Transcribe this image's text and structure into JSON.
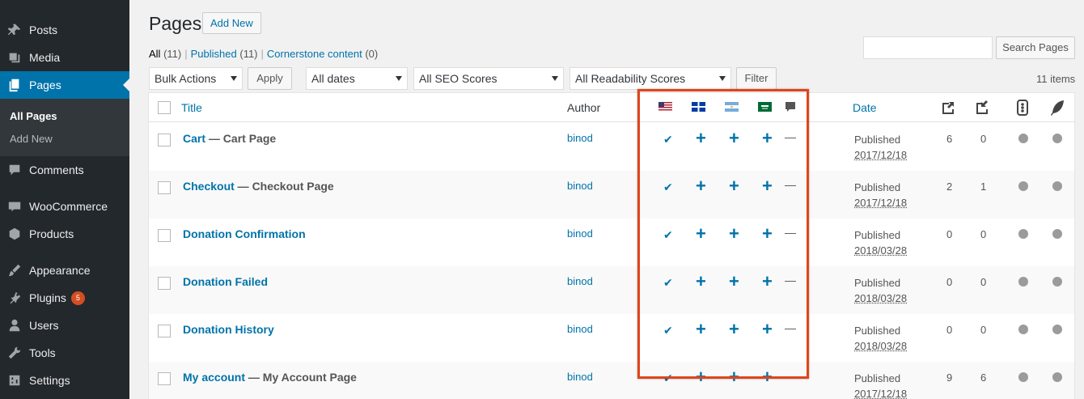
{
  "sidebar": {
    "items": [
      {
        "label": "Posts",
        "icon": "pin-icon"
      },
      {
        "label": "Media",
        "icon": "media-icon"
      },
      {
        "label": "Pages",
        "icon": "pages-icon"
      },
      {
        "label": "Comments",
        "icon": "comment-icon"
      },
      {
        "label": "WooCommerce",
        "icon": "woocommerce-icon"
      },
      {
        "label": "Products",
        "icon": "box-icon"
      },
      {
        "label": "Appearance",
        "icon": "brush-icon"
      },
      {
        "label": "Plugins",
        "icon": "plugin-icon"
      },
      {
        "label": "Users",
        "icon": "user-icon"
      },
      {
        "label": "Tools",
        "icon": "wrench-icon"
      },
      {
        "label": "Settings",
        "icon": "settings-icon"
      }
    ],
    "plugins_badge": "5",
    "submenu": {
      "all_pages": "All Pages",
      "add_new": "Add New"
    }
  },
  "header": {
    "title": "Pages",
    "add_new": "Add New"
  },
  "filters": {
    "all": "All",
    "all_count": "(11)",
    "published": "Published",
    "published_count": "(11)",
    "cornerstone": "Cornerstone content",
    "cornerstone_count": "(0)"
  },
  "search": {
    "button": "Search Pages"
  },
  "toolbar": {
    "bulk_actions": "Bulk Actions",
    "apply": "Apply",
    "dates": "All dates",
    "seo": "All SEO Scores",
    "readability": "All Readability Scores",
    "filter": "Filter",
    "items_count": "11 items"
  },
  "table": {
    "headers": {
      "title": "Title",
      "author": "Author",
      "date": "Date"
    },
    "rows": [
      {
        "title": "Cart",
        "state": " — Cart Page",
        "author": "binod",
        "status": "Published",
        "date": "2017/12/18",
        "links_out": "6",
        "links_in": "0"
      },
      {
        "title": "Checkout",
        "state": " — Checkout Page",
        "author": "binod",
        "status": "Published",
        "date": "2017/12/18",
        "links_out": "2",
        "links_in": "1"
      },
      {
        "title": "Donation Confirmation",
        "state": "",
        "author": "binod",
        "status": "Published",
        "date": "2018/03/28",
        "links_out": "0",
        "links_in": "0"
      },
      {
        "title": "Donation Failed",
        "state": "",
        "author": "binod",
        "status": "Published",
        "date": "2018/03/28",
        "links_out": "0",
        "links_in": "0"
      },
      {
        "title": "Donation History",
        "state": "",
        "author": "binod",
        "status": "Published",
        "date": "2018/03/28",
        "links_out": "0",
        "links_in": "0"
      },
      {
        "title": "My account",
        "state": " — My Account Page",
        "author": "binod",
        "status": "Published",
        "date": "2017/12/18",
        "links_out": "9",
        "links_in": "6"
      }
    ]
  },
  "colors": {
    "accent": "#0073aa",
    "sidebar": "#23282d",
    "highlight": "#e0451a"
  }
}
